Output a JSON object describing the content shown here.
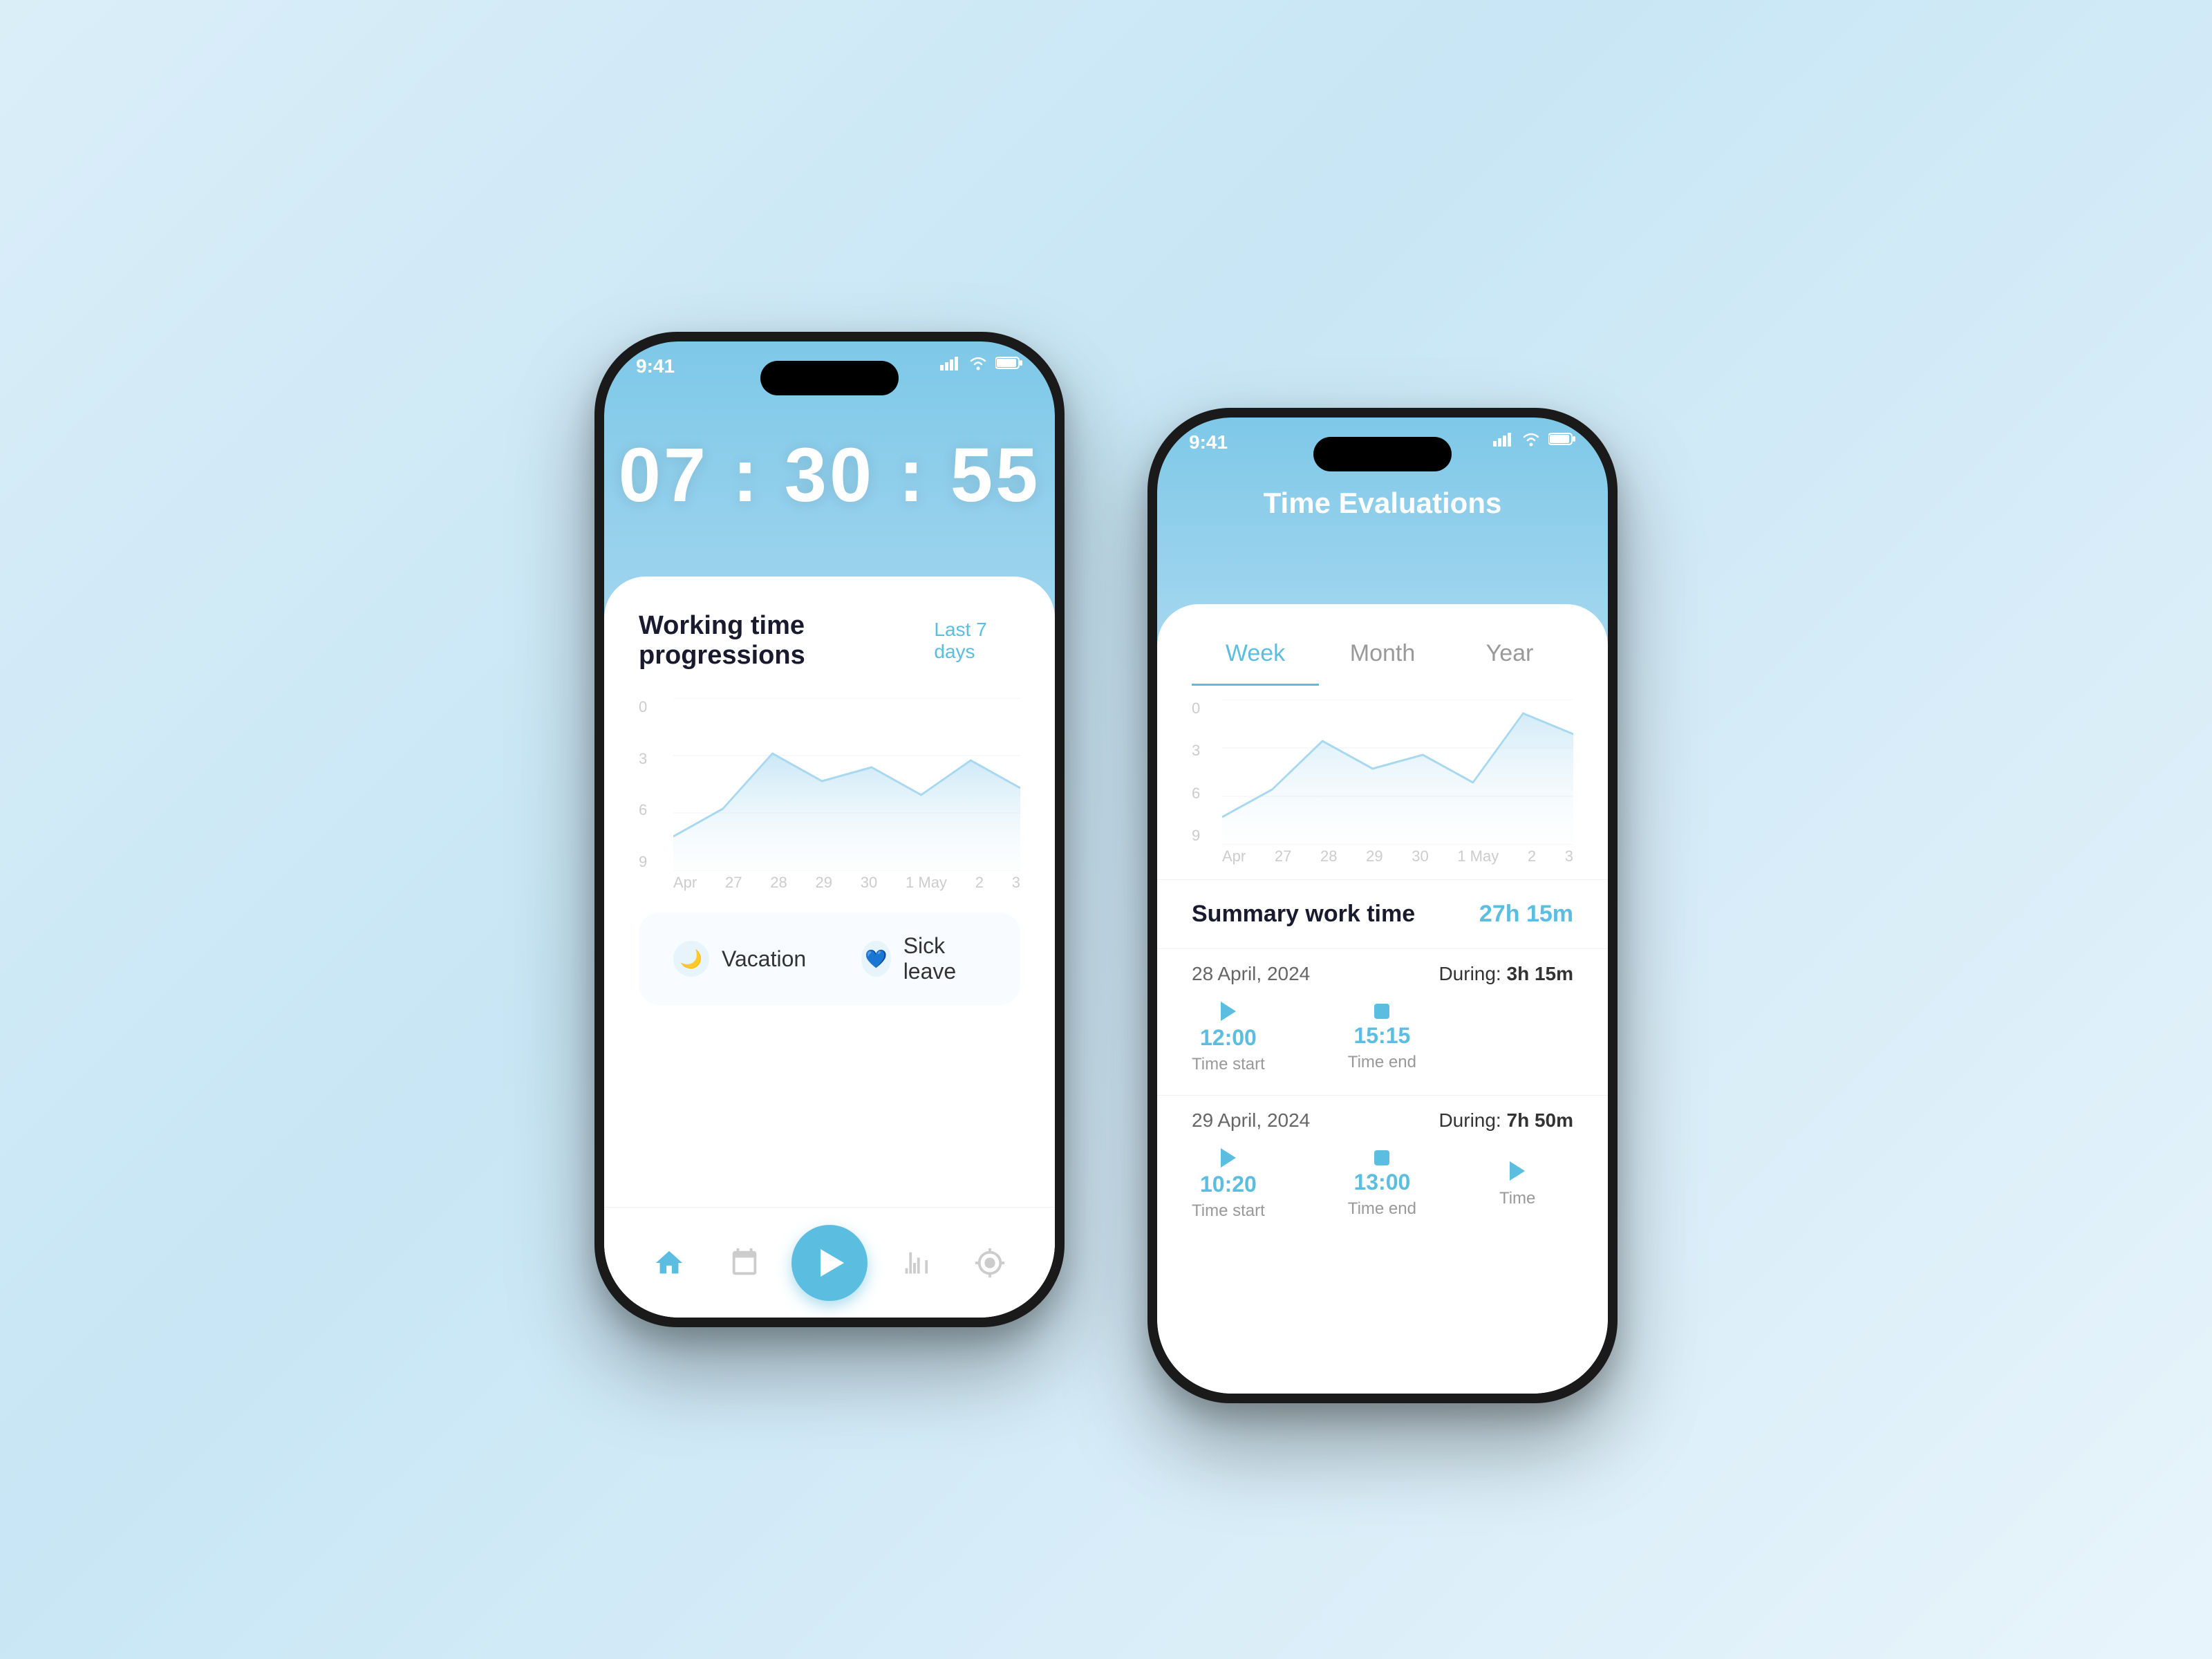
{
  "background": {
    "gradient_start": "#daeef8",
    "gradient_end": "#e8f4fb"
  },
  "phone1": {
    "status_bar": {
      "time": "9:41",
      "signal": "signal-icon",
      "wifi": "wifi-icon",
      "battery": "battery-icon"
    },
    "clock": {
      "display": "07 : 30 : 55"
    },
    "card": {
      "title": "Working time progressions",
      "subtitle": "Last 7 days",
      "chart": {
        "y_labels": [
          "9",
          "6",
          "3",
          "0"
        ],
        "x_labels": [
          "Apr",
          "27",
          "28",
          "29",
          "30",
          "1 May",
          "2",
          "3"
        ]
      },
      "legend": {
        "items": [
          {
            "icon": "🌙",
            "label": "Vacation",
            "type": "vacation"
          },
          {
            "icon": "💙",
            "label": "Sick leave",
            "type": "sick"
          }
        ]
      }
    },
    "nav": {
      "items": [
        "home",
        "calendar",
        "play",
        "stats",
        "settings"
      ]
    }
  },
  "phone2": {
    "status_bar": {
      "time": "9:41"
    },
    "header": {
      "title": "Time Evaluations"
    },
    "tabs": [
      {
        "label": "Week",
        "active": true
      },
      {
        "label": "Month",
        "active": false
      },
      {
        "label": "Year",
        "active": false
      }
    ],
    "chart": {
      "y_labels": [
        "9",
        "6",
        "3",
        "0"
      ],
      "x_labels": [
        "Apr",
        "27",
        "28",
        "29",
        "30",
        "1 May",
        "2",
        "3"
      ]
    },
    "summary": {
      "label": "Summary work time",
      "value": "27h 15m"
    },
    "entries": [
      {
        "date": "28 April, 2024",
        "during_label": "During:",
        "during_value": "3h 15m",
        "times": [
          {
            "type": "start",
            "value": "12:00",
            "label": "Time start"
          },
          {
            "type": "end",
            "value": "15:15",
            "label": "Time end"
          }
        ]
      },
      {
        "date": "29 April, 2024",
        "during_label": "During:",
        "during_value": "7h 50m",
        "times": [
          {
            "type": "start",
            "value": "10:20",
            "label": "Time start"
          },
          {
            "type": "end",
            "value": "13:00",
            "label": "Time end"
          },
          {
            "type": "start",
            "value": "",
            "label": "Time"
          }
        ]
      }
    ]
  }
}
